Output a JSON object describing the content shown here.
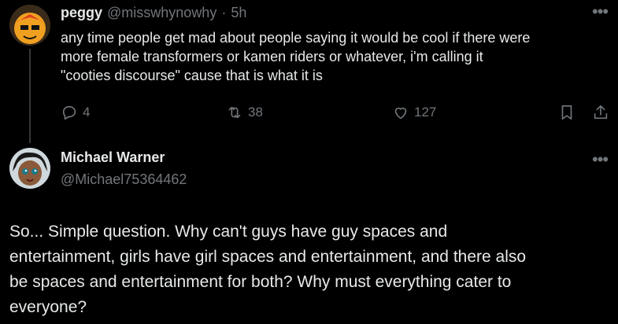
{
  "original_post": {
    "display_name": "peggy",
    "handle": "@misswhynowhy",
    "separator": "·",
    "timestamp": "5h",
    "lines": [
      "any time people get mad about people saying it would be cool if there were",
      "more female transformers or kamen riders or whatever, i'm calling it",
      "\"cooties discourse\" cause that is what it is"
    ],
    "actions": {
      "replies": "4",
      "reposts": "38",
      "likes": "127"
    },
    "more_icon": "more-icon",
    "accent": "#71767b"
  },
  "reply": {
    "display_name": "Michael Warner",
    "handle": "@Michael75364462",
    "lines": [
      "So... Simple question. Why can't guys have guy spaces and",
      "entertainment, girls have girl spaces and entertainment, and there also",
      "be spaces and entertainment for both? Why must everything cater to",
      "everyone?"
    ]
  },
  "colors": {
    "background": "#000000",
    "text": "#e7e9ea",
    "muted": "#71767b",
    "divider": "#333639"
  }
}
